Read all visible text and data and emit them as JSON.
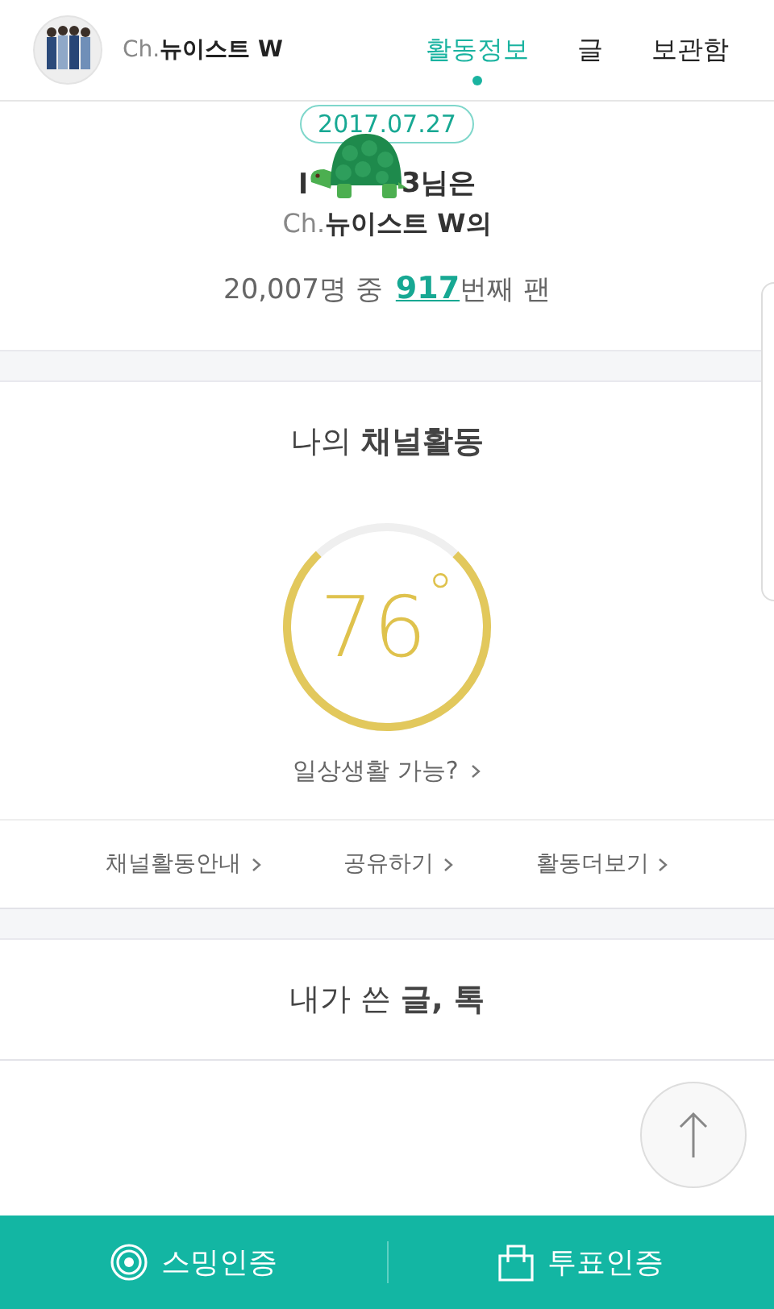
{
  "header": {
    "channel": {
      "prefix": "Ch.",
      "name": "뉴이스트 W"
    },
    "tabs": [
      {
        "label": "활동정보",
        "selected": true
      },
      {
        "label": "글",
        "selected": false
      },
      {
        "label": "보관함",
        "selected": false
      }
    ]
  },
  "fan_card": {
    "date": "2017.07.27",
    "user_before": "l",
    "user_after": "3님은",
    "channel_prefix": "Ch.",
    "channel_name": "뉴이스트 W의",
    "rank_prefix": "20,007명 중",
    "rank": "917",
    "rank_suffix": "번째 팬"
  },
  "activity": {
    "title": "나의 **채널활동**",
    "gauge": {
      "value": "76",
      "unit": "°",
      "level": 0.76
    },
    "status_link": "일상생활 가능?",
    "links": [
      {
        "label": "채널활동안내"
      },
      {
        "label": "공유하기"
      },
      {
        "label": "활동더보기"
      }
    ]
  },
  "posts": {
    "title": "내가 쓴 **글, 톡**"
  },
  "bottom_bar": [
    {
      "label": "스밍인증",
      "kind": "streaming"
    },
    {
      "label": "투표인증",
      "kind": "vote"
    }
  ]
}
